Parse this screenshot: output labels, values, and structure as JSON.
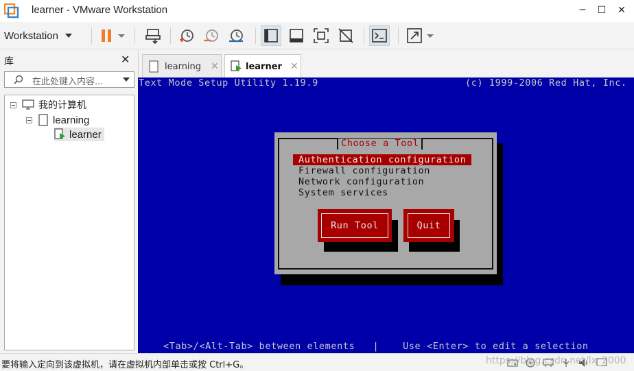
{
  "window": {
    "title": "learner - VMware Workstation",
    "minimize": "─",
    "maximize": "☐",
    "close": "✕"
  },
  "toolbar": {
    "workstation_menu": "Workstation"
  },
  "library": {
    "title": "库",
    "close": "✕",
    "search_placeholder": "在此处键入内容...",
    "tree": [
      {
        "label": "我的计算机"
      },
      {
        "label": "learning"
      },
      {
        "label": "learner"
      }
    ]
  },
  "tabs": [
    {
      "label": "learning",
      "active": false
    },
    {
      "label": "learner",
      "active": true
    }
  ],
  "console": {
    "header_left": "Text Mode Setup Utility 1.19.9",
    "header_right": "(c) 1999-2006 Red Hat, Inc.",
    "dialog_title": "Choose a Tool",
    "options": [
      "Authentication configuration",
      "Firewall configuration",
      "Network configuration",
      "System services"
    ],
    "selected_option": 0,
    "buttons": [
      "Run Tool",
      "Quit"
    ],
    "footer": "<Tab>/<Alt-Tab> between elements   |    Use <Enter> to edit a selection"
  },
  "statusbar": {
    "message": "要将输入定向到该虚拟机，请在虚拟机内部单击或按 Ctrl+G。",
    "watermark": "https://blog.csdn.net/lx_2000"
  },
  "colors": {
    "console_bg": "#0000a8",
    "dialog_bg": "#a8a8a8",
    "accent_red": "#a80000",
    "pause_orange": "#f07c2a"
  }
}
